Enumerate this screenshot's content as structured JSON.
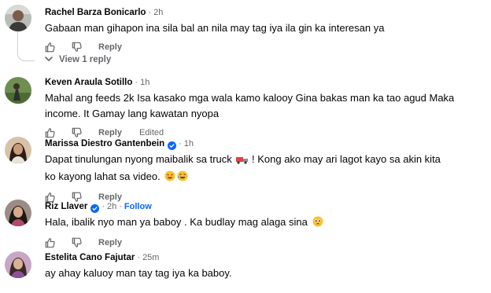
{
  "comments": [
    {
      "author": "Rachel Barza Bonicarlo",
      "time": "2h",
      "text": "Gabaan man gihapon ina sila bal an nila may tag iya ila gin ka interesan ya",
      "reply_label": "Reply",
      "view_replies": "View 1 reply"
    },
    {
      "author": "Keven Araula Sotillo",
      "time": "1h",
      "text_line1": "Mahal ang feeds 2k Isa kasako mga wala kamo kalooy Gina bakas man ka tao agud Maka",
      "text_line2": "income. It Gamay lang kawatan nyopa",
      "reply_label": "Reply",
      "edited_label": "Edited"
    },
    {
      "author": "Marissa Diestro Gantenbein",
      "time": "1h",
      "text_line1_a": "Dapat tinulungan nyong maibalik sa truck",
      "text_line1_b": " ! Kong ako may ari lagot kayo sa akin kita",
      "text_line2": "ko kayong lahat sa video.",
      "reply_label": "Reply"
    },
    {
      "author": "Riz Llaver",
      "time": "2h",
      "follow_label": "Follow",
      "text": "Hala, ibalik nyo man ya baboy . Ka budlay mag alaga sina",
      "reply_label": "Reply"
    },
    {
      "author": "Estelita Cano Fajutar",
      "time": "25m",
      "text": "ay ahay kaluoy man tay tag iya ka baboy."
    }
  ],
  "separator": "·",
  "icons": {
    "like": "thumbs-up-icon",
    "dislike": "thumbs-down-icon",
    "verified": "verified-badge-icon",
    "chevron": "chevron-down-icon"
  },
  "colors": {
    "text": "#050505",
    "muted": "#65676b",
    "accent": "#0866ff"
  }
}
